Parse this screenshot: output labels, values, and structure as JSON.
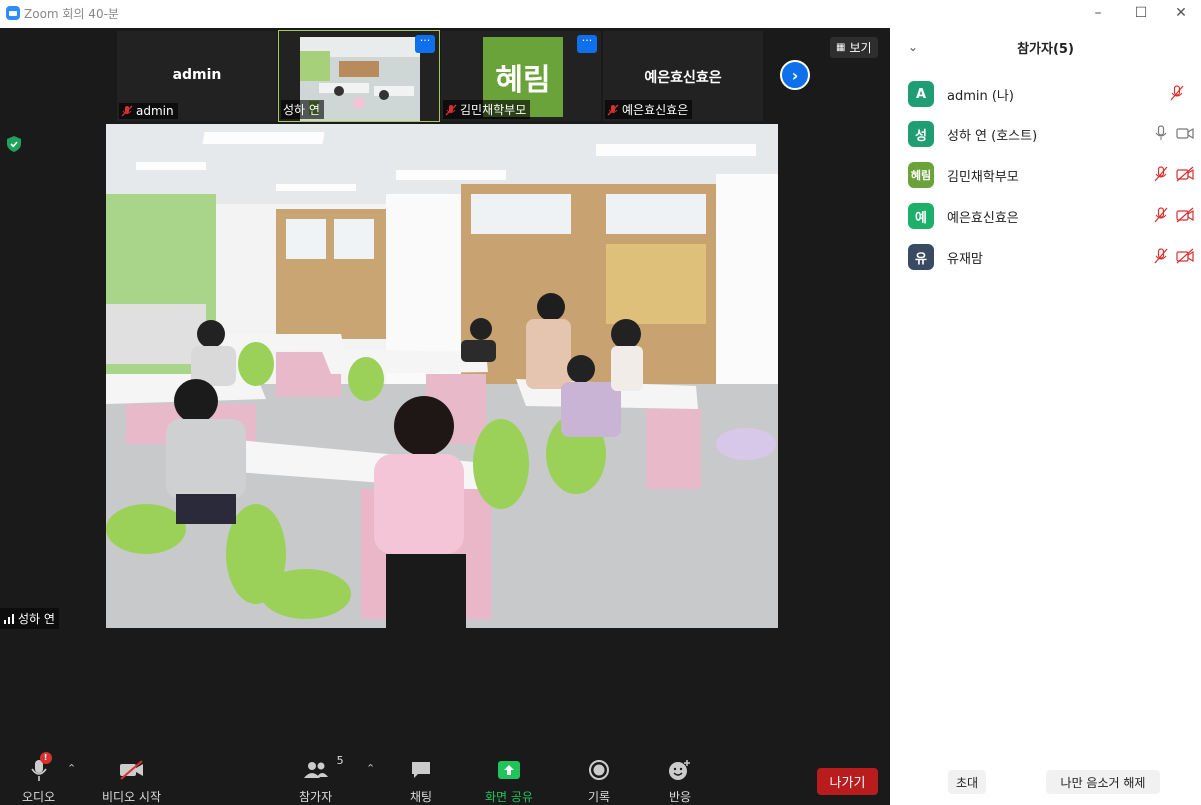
{
  "window": {
    "title": "Zoom 회의 40-분"
  },
  "thumbnails": [
    {
      "center_text": "admin",
      "name": "admin",
      "muted": true
    },
    {
      "center_text": "",
      "name": "성하 연",
      "muted": false,
      "active": true
    },
    {
      "center_text": "혜림",
      "name": "김민채학부모",
      "muted": true
    },
    {
      "center_text": "예은효신효은",
      "name": "예은효신효은",
      "muted": true
    }
  ],
  "view_button": "보기",
  "active_speaker": "성하 연",
  "toolbar": {
    "audio": "오디오",
    "audio_badge": "!",
    "video": "비디오 시작",
    "participants": "참가자",
    "participants_count": "5",
    "chat": "채팅",
    "share": "화면 공유",
    "record": "기록",
    "reactions": "반응",
    "leave": "나가기"
  },
  "panel": {
    "title": "참가자(5)",
    "participants": [
      {
        "initial": "A",
        "name": "admin (나)",
        "color": "#1f9e74"
      },
      {
        "initial": "성",
        "name": "성하 연 (호스트)",
        "color": "#1f9e74"
      },
      {
        "initial": "혜림",
        "name": "김민채학부모",
        "color": "#6aa33a"
      },
      {
        "initial": "예",
        "name": "예은효신효은",
        "color": "#1db06b"
      },
      {
        "initial": "유",
        "name": "유재맘",
        "color": "#3a4a63"
      }
    ],
    "invite": "초대",
    "unmute_me": "나만 음소거 해제"
  },
  "colors": {
    "accent": "#0e71eb",
    "danger": "#b91c1c",
    "muted_icon": "#d93030"
  }
}
